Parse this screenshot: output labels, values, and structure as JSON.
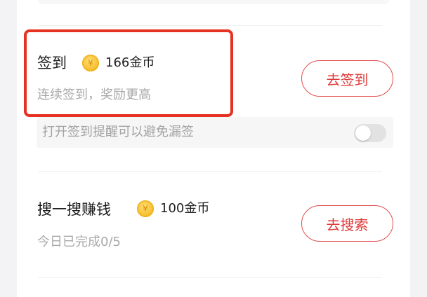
{
  "checkin": {
    "title": "签到",
    "coin_symbol": "¥",
    "reward": "166金币",
    "subtitle": "连续签到，奖励更高",
    "button_label": "去签到",
    "reminder_text": "打开签到提醒可以避免漏签",
    "reminder_enabled": false
  },
  "search_task": {
    "title": "搜一搜赚钱",
    "coin_symbol": "¥",
    "reward": "100金币",
    "progress_text": "今日已完成0/5",
    "button_label": "去搜索"
  },
  "colors": {
    "accent_red": "#e03a3a",
    "highlight_red": "#e53222",
    "coin_gold": "#f7c235"
  }
}
